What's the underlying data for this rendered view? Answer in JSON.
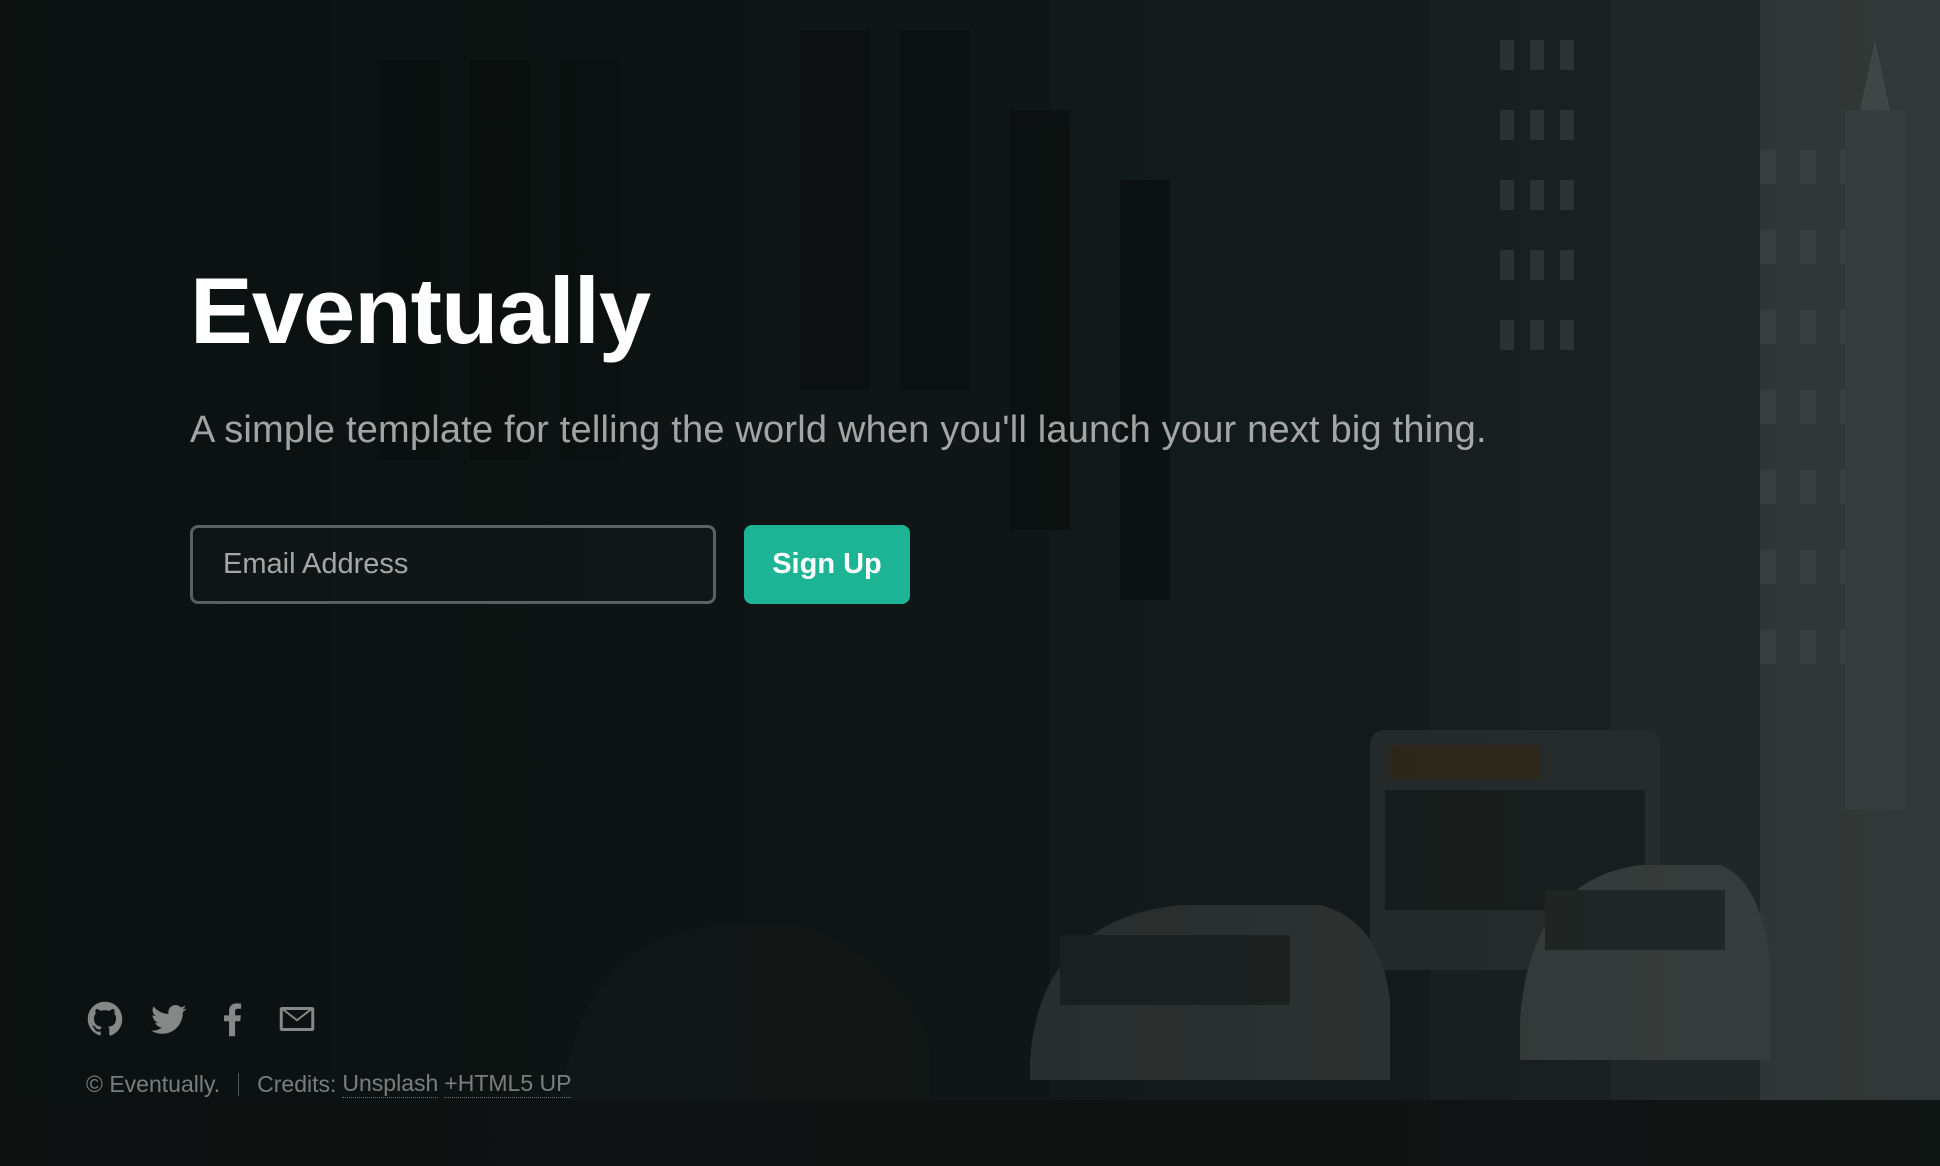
{
  "header": {
    "title": "Eventually",
    "tagline": "A simple template for telling the world when you'll launch your next big thing."
  },
  "signup": {
    "email_placeholder": "Email Address",
    "email_value": "",
    "button_label": "Sign Up"
  },
  "footer": {
    "social_icons": [
      "github-icon",
      "twitter-icon",
      "facebook-icon",
      "envelope-icon"
    ],
    "copyright": "© Eventually.",
    "credits_label": "Credits:",
    "credit_links": [
      "Unsplash",
      "+HTML5 UP"
    ]
  },
  "colors": {
    "accent": "#1cb495",
    "title": "#ffffff",
    "background": "#0f1514"
  }
}
